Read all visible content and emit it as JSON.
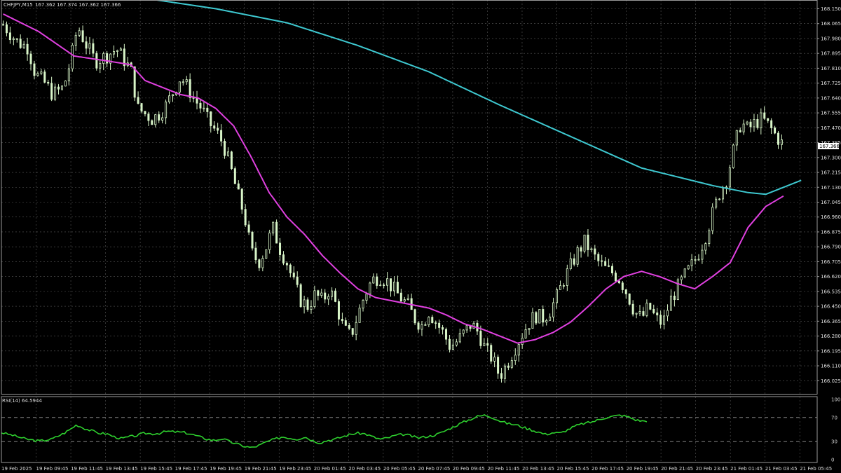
{
  "header": {
    "symbol_label": "CHFJPY,M15",
    "ohlc_text": "167.362 167.374 167.362 167.366"
  },
  "price_tag": "167.366",
  "rsi": {
    "label": "RSI(14) 64.5944"
  },
  "colors": {
    "background": "#000000",
    "grid": "#5a5a5a",
    "candle": "#d8f5c8",
    "sma_fast": "#e040e0",
    "sma_slow": "#3ec8d0",
    "rsi_line": "#2ed02e",
    "axis_text": "#dcdcdc"
  },
  "chart_data": [
    {
      "type": "candlestick",
      "title": "CHFJPY,M15",
      "ylim": [
        165.95,
        168.2
      ],
      "yticks": [
        "168.150",
        "168.065",
        "167.980",
        "167.895",
        "167.810",
        "167.725",
        "167.640",
        "167.555",
        "167.470",
        "167.385",
        "167.300",
        "167.215",
        "167.130",
        "167.045",
        "166.960",
        "166.875",
        "166.790",
        "166.705",
        "166.620",
        "166.535",
        "166.450",
        "166.365",
        "166.280",
        "166.195",
        "166.110",
        "166.025"
      ],
      "xticks": [
        "19 Feb 2025",
        "19 Feb 09:45",
        "19 Feb 11:45",
        "19 Feb 13:45",
        "19 Feb 15:45",
        "19 Feb 17:45",
        "19 Feb 19:45",
        "19 Feb 21:45",
        "19 Feb 23:45",
        "20 Feb 01:45",
        "20 Feb 03:45",
        "20 Feb 05:45",
        "20 Feb 07:45",
        "20 Feb 09:45",
        "20 Feb 11:45",
        "20 Feb 13:45",
        "20 Feb 15:45",
        "20 Feb 17:45",
        "20 Feb 19:45",
        "20 Feb 21:45",
        "20 Feb 23:45",
        "21 Feb 01:45",
        "21 Feb 03:45",
        "21 Feb 05:45"
      ],
      "close_path": [
        [
          0,
          168.06
        ],
        [
          4,
          167.96
        ],
        [
          7,
          167.93
        ],
        [
          9,
          167.78
        ],
        [
          12,
          167.72
        ],
        [
          14,
          167.66
        ],
        [
          17,
          167.7
        ],
        [
          19,
          167.85
        ],
        [
          21,
          168.05
        ],
        [
          23,
          167.96
        ],
        [
          26,
          167.85
        ],
        [
          29,
          167.88
        ],
        [
          32,
          167.92
        ],
        [
          34,
          167.86
        ],
        [
          36,
          167.8
        ],
        [
          38,
          167.58
        ],
        [
          40,
          167.55
        ],
        [
          42,
          167.52
        ],
        [
          44,
          167.55
        ],
        [
          46,
          167.6
        ],
        [
          48,
          167.68
        ],
        [
          50,
          167.76
        ],
        [
          52,
          167.7
        ],
        [
          54,
          167.63
        ],
        [
          56,
          167.58
        ],
        [
          58,
          167.5
        ],
        [
          60,
          167.45
        ],
        [
          62,
          167.38
        ],
        [
          64,
          167.25
        ],
        [
          66,
          167.1
        ],
        [
          68,
          166.97
        ],
        [
          70,
          166.76
        ],
        [
          72,
          166.7
        ],
        [
          74,
          166.78
        ],
        [
          76,
          166.9
        ],
        [
          78,
          166.78
        ],
        [
          80,
          166.7
        ],
        [
          82,
          166.58
        ],
        [
          84,
          166.48
        ],
        [
          86,
          166.45
        ],
        [
          88,
          166.52
        ],
        [
          90,
          166.48
        ],
        [
          92,
          166.55
        ],
        [
          94,
          166.45
        ],
        [
          96,
          166.32
        ],
        [
          98,
          166.28
        ],
        [
          100,
          166.4
        ],
        [
          102,
          166.52
        ],
        [
          104,
          166.6
        ],
        [
          106,
          166.62
        ],
        [
          108,
          166.6
        ],
        [
          110,
          166.55
        ],
        [
          112,
          166.5
        ],
        [
          114,
          166.46
        ],
        [
          116,
          166.38
        ],
        [
          118,
          166.34
        ],
        [
          120,
          166.42
        ],
        [
          122,
          166.36
        ],
        [
          124,
          166.3
        ],
        [
          126,
          166.22
        ],
        [
          128,
          166.25
        ],
        [
          130,
          166.3
        ],
        [
          132,
          166.35
        ],
        [
          134,
          166.3
        ],
        [
          136,
          166.2
        ],
        [
          138,
          166.15
        ],
        [
          140,
          166.05
        ],
        [
          142,
          166.12
        ],
        [
          144,
          166.2
        ],
        [
          146,
          166.28
        ],
        [
          148,
          166.35
        ],
        [
          150,
          166.4
        ],
        [
          152,
          166.38
        ],
        [
          154,
          166.42
        ],
        [
          156,
          166.5
        ],
        [
          158,
          166.6
        ],
        [
          160,
          166.68
        ],
        [
          162,
          166.76
        ],
        [
          164,
          166.82
        ],
        [
          166,
          166.75
        ],
        [
          168,
          166.7
        ],
        [
          170,
          166.66
        ],
        [
          172,
          166.64
        ],
        [
          174,
          166.6
        ],
        [
          176,
          166.52
        ],
        [
          178,
          166.42
        ],
        [
          180,
          166.38
        ],
        [
          182,
          166.45
        ],
        [
          184,
          166.38
        ],
        [
          186,
          166.35
        ],
        [
          188,
          166.48
        ],
        [
          190,
          166.55
        ],
        [
          192,
          166.62
        ],
        [
          194,
          166.68
        ],
        [
          196,
          166.75
        ],
        [
          198,
          166.85
        ],
        [
          200,
          166.98
        ],
        [
          202,
          167.1
        ],
        [
          204,
          167.18
        ],
        [
          206,
          167.35
        ],
        [
          208,
          167.5
        ],
        [
          210,
          167.46
        ],
        [
          212,
          167.5
        ],
        [
          214,
          167.52
        ],
        [
          216,
          167.48
        ],
        [
          218,
          167.42
        ],
        [
          220,
          167.37
        ]
      ],
      "series": [
        {
          "values": [
            [
              0,
              168.12
            ],
            [
              10,
              168.02
            ],
            [
              20,
              167.88
            ],
            [
              30,
              167.85
            ],
            [
              36,
              167.83
            ],
            [
              40,
              167.74
            ],
            [
              45,
              167.7
            ],
            [
              50,
              167.66
            ],
            [
              55,
              167.64
            ],
            [
              60,
              167.58
            ],
            [
              65,
              167.48
            ],
            [
              70,
              167.3
            ],
            [
              75,
              167.1
            ],
            [
              80,
              166.96
            ],
            [
              85,
              166.86
            ],
            [
              90,
              166.74
            ],
            [
              95,
              166.64
            ],
            [
              100,
              166.55
            ],
            [
              105,
              166.5
            ],
            [
              110,
              166.48
            ],
            [
              115,
              166.46
            ],
            [
              120,
              166.44
            ],
            [
              125,
              166.4
            ],
            [
              130,
              166.35
            ],
            [
              135,
              166.32
            ],
            [
              140,
              166.28
            ],
            [
              145,
              166.24
            ],
            [
              150,
              166.26
            ],
            [
              155,
              166.3
            ],
            [
              160,
              166.36
            ],
            [
              165,
              166.45
            ],
            [
              170,
              166.55
            ],
            [
              175,
              166.62
            ],
            [
              180,
              166.65
            ],
            [
              185,
              166.62
            ],
            [
              190,
              166.58
            ],
            [
              195,
              166.55
            ],
            [
              200,
              166.62
            ],
            [
              205,
              166.7
            ],
            [
              210,
              166.9
            ],
            [
              215,
              167.02
            ],
            [
              220,
              167.08
            ]
          ]
        },
        {
          "values": [
            [
              20,
              168.26
            ],
            [
              40,
              168.21
            ],
            [
              60,
              168.15
            ],
            [
              80,
              168.07
            ],
            [
              100,
              167.94
            ],
            [
              120,
              167.79
            ],
            [
              140,
              167.6
            ],
            [
              160,
              167.42
            ],
            [
              180,
              167.24
            ],
            [
              200,
              167.14
            ],
            [
              210,
              167.1
            ],
            [
              215,
              167.09
            ],
            [
              220,
              167.13
            ],
            [
              225,
              167.17
            ]
          ]
        }
      ]
    },
    {
      "type": "line",
      "title": "RSI(14) 64.5944",
      "ylim": [
        0,
        100
      ],
      "yticks": [
        "100",
        "70",
        "30",
        "0"
      ],
      "levels": [
        70,
        30
      ],
      "series": [
        {
          "values": [
            [
              0,
              45
            ],
            [
              5,
              40
            ],
            [
              10,
              34
            ],
            [
              15,
              31
            ],
            [
              20,
              34
            ],
            [
              25,
              44
            ],
            [
              28,
              52
            ],
            [
              30,
              58
            ],
            [
              33,
              52
            ],
            [
              36,
              48
            ],
            [
              39,
              44
            ],
            [
              42,
              43
            ],
            [
              45,
              38
            ],
            [
              48,
              35
            ],
            [
              51,
              38
            ],
            [
              54,
              40
            ],
            [
              57,
              44
            ],
            [
              60,
              43
            ],
            [
              63,
              44
            ],
            [
              66,
              47
            ],
            [
              70,
              46
            ],
            [
              73,
              45
            ],
            [
              76,
              42
            ],
            [
              79,
              38
            ],
            [
              82,
              34
            ],
            [
              85,
              32
            ],
            [
              88,
              35
            ],
            [
              91,
              30
            ],
            [
              94,
              26
            ],
            [
              97,
              22
            ],
            [
              100,
              20
            ],
            [
              103,
              24
            ],
            [
              106,
              30
            ],
            [
              109,
              34
            ],
            [
              112,
              38
            ],
            [
              115,
              36
            ],
            [
              118,
              34
            ],
            [
              121,
              38
            ],
            [
              124,
              32
            ],
            [
              127,
              28
            ],
            [
              130,
              32
            ],
            [
              133,
              34
            ],
            [
              136,
              38
            ],
            [
              139,
              42
            ],
            [
              142,
              44
            ],
            [
              145,
              43
            ],
            [
              148,
              38
            ],
            [
              151,
              34
            ],
            [
              154,
              36
            ],
            [
              157,
              40
            ],
            [
              160,
              42
            ],
            [
              163,
              40
            ],
            [
              166,
              36
            ],
            [
              169,
              38
            ],
            [
              172,
              40
            ],
            [
              175,
              44
            ],
            [
              178,
              50
            ],
            [
              181,
              56
            ],
            [
              184,
              62
            ],
            [
              187,
              67
            ],
            [
              190,
              72
            ],
            [
              193,
              74
            ],
            [
              196,
              70
            ],
            [
              199,
              64
            ],
            [
              202,
              60
            ],
            [
              205,
              58
            ],
            [
              208,
              54
            ],
            [
              211,
              50
            ],
            [
              214,
              46
            ],
            [
              217,
              42
            ],
            [
              220,
              45
            ],
            [
              223,
              44
            ],
            [
              226,
              50
            ],
            [
              229,
              56
            ],
            [
              232,
              60
            ],
            [
              235,
              62
            ],
            [
              238,
              66
            ],
            [
              241,
              70
            ],
            [
              244,
              72
            ],
            [
              247,
              74
            ],
            [
              250,
              71
            ],
            [
              253,
              66
            ],
            [
              256,
              64
            ],
            [
              258,
              65
            ]
          ]
        }
      ]
    }
  ]
}
